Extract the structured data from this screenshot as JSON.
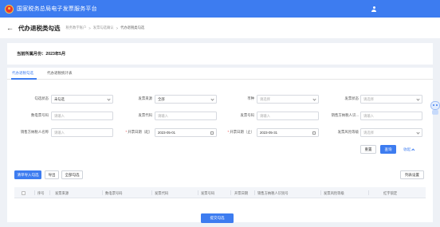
{
  "topbar": {
    "title": "国家税务总局电子发票服务平台"
  },
  "header": {
    "title": "代办退税类勾选",
    "breadcrumb": [
      "税务数字账户",
      "发票勾选确认",
      "代办退税类勾选"
    ]
  },
  "period": {
    "label": "当前所属月份：",
    "value": "2023年5月"
  },
  "tabs": [
    {
      "label": "代办退税勾选",
      "active": true
    },
    {
      "label": "代办退税统计表",
      "active": false
    }
  ],
  "filters": {
    "status": {
      "label": "勾选状态",
      "value": "未勾选"
    },
    "invoice_source": {
      "label": "发票来源",
      "value": "全部"
    },
    "currency": {
      "label": "币种",
      "placeholder": "请选择"
    },
    "invoice_status": {
      "label": "发票状态",
      "placeholder": "请选择"
    },
    "digital_invoice_no": {
      "label": "数电票号码",
      "placeholder": "请输入"
    },
    "invoice_code": {
      "label": "发票代码",
      "placeholder": "请输入"
    },
    "invoice_no": {
      "label": "发票号码",
      "placeholder": "请输入"
    },
    "seller_tax_id": {
      "label": "销售方纳税人识...",
      "placeholder": "请输入"
    },
    "seller_name": {
      "label": "销售方纳税人名称",
      "placeholder": "请输入"
    },
    "date_start": {
      "label": "开票日期（起）",
      "value": "2023-05-01"
    },
    "date_end": {
      "label": "开票日期（止）",
      "value": "2023-05-31"
    },
    "risk_level": {
      "label": "发票风险等级",
      "placeholder": "请选择"
    }
  },
  "actions": {
    "reset": "重置",
    "search": "查询",
    "collapse": "收起"
  },
  "toolbar": {
    "import_select": "清单导入勾选",
    "export": "导出",
    "select_all": "全部勾选",
    "column_settings": "列表设置"
  },
  "table": {
    "columns": [
      "序号",
      "发票来源",
      "数电票号码",
      "发票代码",
      "发票号码",
      "开票日期",
      "销售方纳税人识别号",
      "发票风险等级",
      "红字锁定"
    ]
  },
  "footer": {
    "submit": "提交勾选"
  },
  "colors": {
    "brand": "#3d7cf0",
    "required": "#e54545"
  }
}
